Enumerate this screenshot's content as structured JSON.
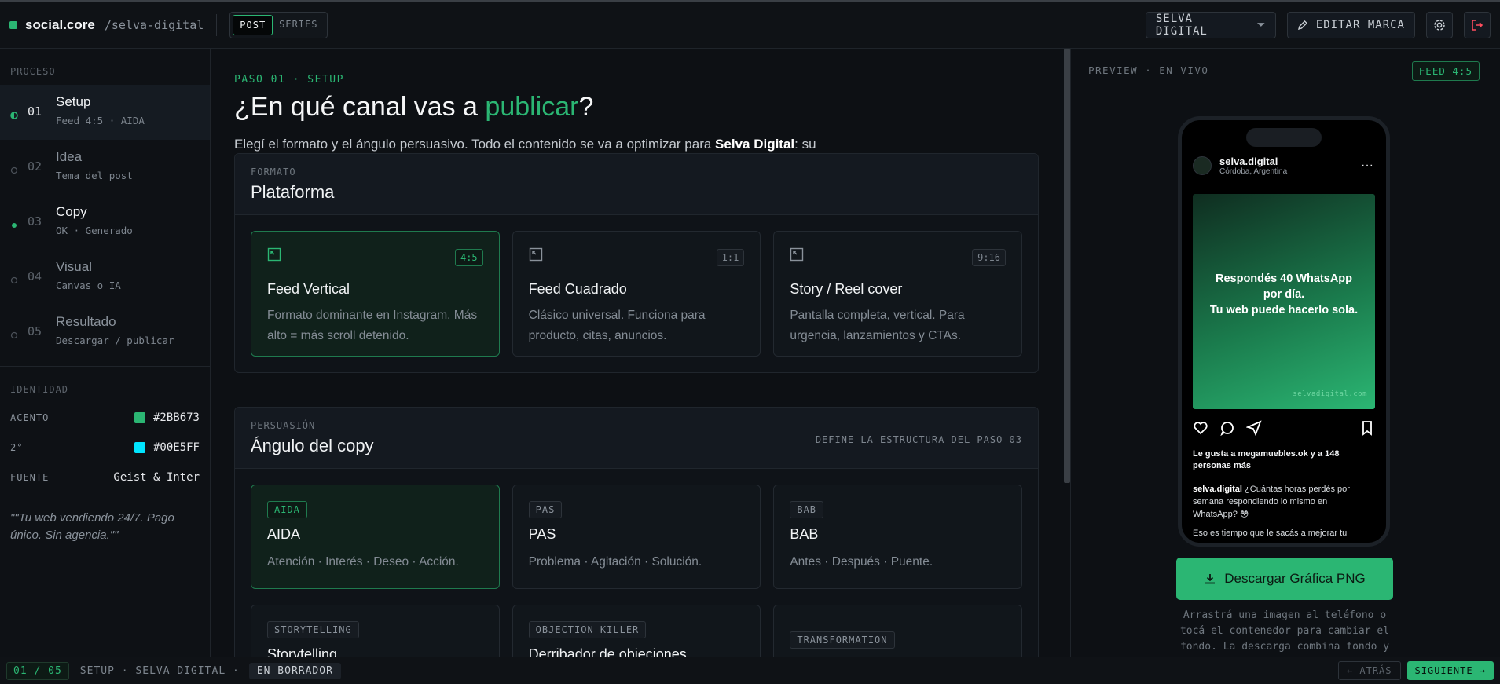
{
  "header": {
    "brand": "social.core",
    "path": "/selva-digital",
    "mode_tabs": [
      "POST",
      "SERIES"
    ],
    "brand_select": "SELVA DIGITAL",
    "edit_brand": "EDITAR MARCA"
  },
  "sidebar": {
    "process_label": "PROCESO",
    "steps": [
      {
        "num": "01",
        "title": "Setup",
        "sub": "Feed 4:5 · AIDA",
        "state": "active"
      },
      {
        "num": "02",
        "title": "Idea",
        "sub": "Tema del post",
        "state": "pending"
      },
      {
        "num": "03",
        "title": "Copy",
        "sub": "OK · Generado",
        "state": "done"
      },
      {
        "num": "04",
        "title": "Visual",
        "sub": "Canvas o IA",
        "state": "pending"
      },
      {
        "num": "05",
        "title": "Resultado",
        "sub": "Descargar / publicar",
        "state": "pending"
      }
    ],
    "identity_label": "IDENTIDAD",
    "identity": {
      "accent_label": "ACENTO",
      "accent_value": "#2BB673",
      "secondary_label": "2°",
      "secondary_value": "#00E5FF",
      "font_label": "FUENTE",
      "font_value": "Geist & Inter"
    },
    "quote": "\"\"Tu web vendiendo 24/7. Pago único. Sin agencia.\"\""
  },
  "main": {
    "eyebrow": "PASO 01 · SETUP",
    "title_pre": "¿En qué canal vas a ",
    "title_accent": "publicar",
    "title_post": "?",
    "lead_pre": "Elegí el formato y el ángulo persuasivo. Todo el contenido se va a optimizar para ",
    "lead_brand": "Selva Digital",
    "lead_post": ": su tono, su audiencia y su paleta.",
    "format": {
      "kicker": "FORMATO",
      "title": "Plataforma",
      "cards": [
        {
          "tag": "4:5",
          "title": "Feed Vertical",
          "desc": "Formato dominante en Instagram. Más alto = más scroll detenido."
        },
        {
          "tag": "1:1",
          "title": "Feed Cuadrado",
          "desc": "Clásico universal. Funciona para producto, citas, anuncios."
        },
        {
          "tag": "9:16",
          "title": "Story / Reel cover",
          "desc": "Pantalla completa, vertical. Para urgencia, lanzamientos y CTAs."
        }
      ]
    },
    "angle": {
      "kicker": "PERSUASIÓN",
      "title": "Ángulo del copy",
      "note": "DEFINE LA ESTRUCTURA DEL PASO 03",
      "cards": [
        {
          "pill": "AIDA",
          "title": "AIDA",
          "desc": "Atención · Interés · Deseo · Acción."
        },
        {
          "pill": "PAS",
          "title": "PAS",
          "desc": "Problema · Agitación · Solución."
        },
        {
          "pill": "BAB",
          "title": "BAB",
          "desc": "Antes · Después · Puente."
        },
        {
          "pill": "STORYTELLING",
          "title": "Storytelling",
          "desc": ""
        },
        {
          "pill": "OBJECTION KILLER",
          "title": "Derribador de objeciones",
          "desc": ""
        },
        {
          "pill": "TRANSFORMATION",
          "title": "",
          "desc": ""
        }
      ]
    }
  },
  "preview": {
    "label": "PREVIEW · EN VIVO",
    "badge": "FEED 4:5",
    "ig": {
      "user": "selva.digital",
      "location": "Córdoba, Argentina",
      "post_text_1": "Respondés 40 WhatsApp por día.",
      "post_text_2": "Tu web puede hacerlo sola.",
      "watermark": "selvadigital.com",
      "likes": "Le gusta a megamuebles.ok y a 148 personas más",
      "caption_user": "selva.digital",
      "caption": " ¿Cuántas horas perdés por semana respondiendo lo mismo en WhatsApp? 😳",
      "caption_2": "Eso es tiempo que le sacás a mejorar tu"
    },
    "download": "Descargar Gráfica PNG",
    "hint": "Arrastrá una imagen al teléfono o tocá el contenedor para cambiar el fondo. La descarga combina fondo y textos en alta calidad."
  },
  "footer": {
    "count": "01 / 05",
    "crumb": "SETUP · SELVA DIGITAL ·",
    "status": "EN BORRADOR",
    "back": "← ATRÁS",
    "next": "SIGUIENTE →"
  },
  "colors": {
    "accent": "#2BB673",
    "secondary": "#00E5FF"
  }
}
